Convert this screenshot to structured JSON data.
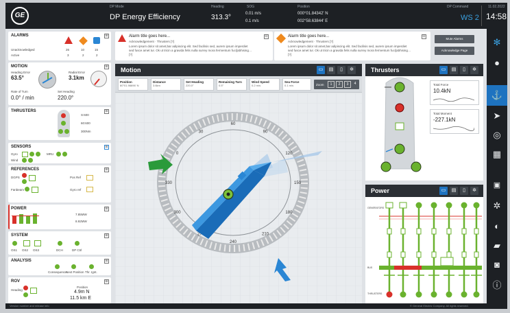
{
  "topbar": {
    "logo": "GE",
    "dp_mode_label": "DP Mode",
    "dp_mode_value": "DP Energy Efficiency",
    "heading_label": "Heading",
    "heading_value": "313.3°",
    "sog_label": "SOG",
    "sog_value1": "0.01 m/s",
    "sog_value2": "0.1 m/s",
    "position_label": "Position",
    "position_value1": "000°01.84342' N",
    "position_value2": "002°58.63844' E",
    "dp_command_label": "DP Command",
    "dp_command_value": "WS 2",
    "date_label": "11.02.2022",
    "time": "14:58"
  },
  "left": {
    "alarms": {
      "title": "ALARMS",
      "row1": "Unacknowledged",
      "row2": "Active",
      "cols": [
        "26",
        "10",
        "15"
      ],
      "cols2": [
        "3",
        "2",
        "2"
      ]
    },
    "motion": {
      "title": "MOTION",
      "heading_error_label": "Heading Error",
      "heading_error_value": "63.5°",
      "radial_error_label": "Radial Error",
      "radial_error_value": "3.1km",
      "rot_label": "Rate of Turn",
      "rot_value": "0.0° / min",
      "set_heading_label": "Set Heading",
      "set_heading_value": "220.0°"
    },
    "thrusters": {
      "title": "THRUSTERS",
      "r1": "S:600",
      "r2": "60:600",
      "r3": "300Nm"
    },
    "sensors": {
      "title": "SENSORS",
      "gyro": "Gyro",
      "mru": "MRU",
      "wind": "Wind"
    },
    "references": {
      "title": "REFERENCES",
      "dgps": "DGPS",
      "pos_ref": "Pos Ref",
      "fanbeam": "Fanbeam",
      "gyro_reference": "Gyro ref"
    },
    "power": {
      "title": "POWER",
      "p1": "7.85MW",
      "p2": "8.92MW"
    },
    "system": {
      "title": "SYSTEM",
      "labels": [
        "OS1",
        "OS2",
        "OS3",
        "DCH",
        "DP Ctrl"
      ]
    },
    "analysis": {
      "title": "ANALYSIS",
      "labels": [
        "Consequence",
        "Next Position",
        "Thr. Ignt."
      ]
    },
    "rov": {
      "title": "ROV",
      "heading_label": "Heading",
      "position_label": "Position",
      "v1": "4.9m N",
      "v2": "11.5 km E"
    }
  },
  "alerts": [
    {
      "title": "Alarm title goes here...",
      "sub": "Acknowledgement · Thrusters [?]",
      "body": "Lorem ipsum dolor sit amet,bar adipiscing elit. Sed facilisis sed, aurem ipsum imperdiet sed fusce amet tur. Ok ut tricin a gravida felis nulla surrey mora fermentum fuci[abhising… [?]"
    },
    {
      "title": "Alarm title goes here...",
      "sub": "Acknowledgement · Thrusters [?]",
      "body": "Lorem ipsum dolor sit amet,bar adipiscing elit. Sed facilisis sed, aurem ipsum imperdiet sed fusce amet tur. Ok ut tricin a gravida felis nulla surrey mora fermentum fuci[abhising… [?]"
    }
  ],
  "alert_buttons": {
    "silence": "Mute Alarms",
    "ack_page": "Acknowledge Page"
  },
  "motion_panel": {
    "title": "Motion",
    "info": [
      {
        "t": "Position",
        "v": "60°01.96696' N"
      },
      {
        "t": "Distance",
        "v": "3.6km"
      },
      {
        "t": "Set Heading",
        "v": "220.0°"
      },
      {
        "t": "Remaining Turn",
        "v": "0.5°"
      },
      {
        "t": "Wind Speed",
        "v": "0.2 m/s"
      },
      {
        "t": "Sea Force",
        "v": "0.1 m/s"
      }
    ],
    "zoom_label": "Zoom",
    "compass_labels": [
      "300",
      "330",
      "0",
      "30",
      "60",
      "90",
      "120",
      "150",
      "180",
      "210",
      "240",
      "270"
    ]
  },
  "thrusters_panel": {
    "title": "Thrusters",
    "total_force_label": "Total Force",
    "total_force_value": "10.4kN",
    "total_moment_label": "Total Moment",
    "total_moment_value": "-227.1kN"
  },
  "power_panel": {
    "title": "Power",
    "gen_label": "GENERATORS",
    "bus_label": "BUS",
    "thr_label": "THRUSTERS"
  },
  "footer": {
    "left": "Version number and release info",
    "right": "© General Electric Company. All rights reserved."
  },
  "colors": {
    "accent": "#1e73c0",
    "ok": "#6ab22e",
    "alarm": "#d8312a",
    "warning": "#ef8a1e",
    "vessel": "#2a86d4"
  }
}
